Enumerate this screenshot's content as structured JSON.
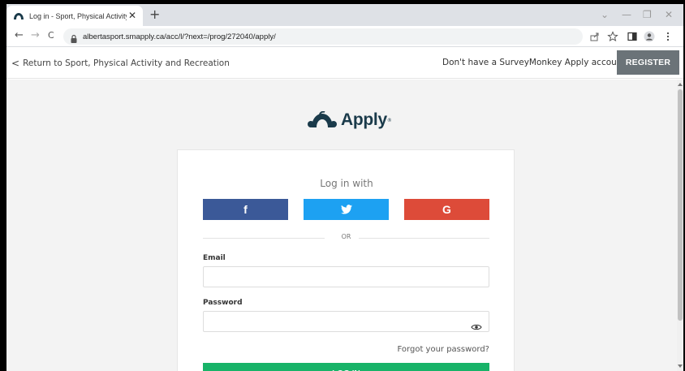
{
  "browser": {
    "tab_title": "Log in - Sport, Physical Activity a",
    "tab_close": "✕",
    "new_tab": "+",
    "window_controls": {
      "tabsearch": "⌄",
      "minimize": "—",
      "restore": "❐",
      "close": "✕"
    },
    "nav": {
      "back": "←",
      "forward": "→",
      "reload": "C"
    },
    "url": "albertasport.smapply.ca/acc/l/?next=/prog/272040/apply/"
  },
  "header": {
    "back_link": "Return to Sport, Physical Activity and Recreation",
    "back_chevron": "<",
    "no_account_text": "Don't have a SurveyMonkey Apply account?",
    "register_label": "REGISTER"
  },
  "logo": {
    "text": "Apply",
    "tm": "®"
  },
  "login": {
    "log_in_with": "Log in with",
    "facebook_label": "f",
    "google_label": "G",
    "or_text": "OR",
    "email_label": "Email",
    "email_value": "",
    "password_label": "Password",
    "password_value": "",
    "forgot_link": "Forgot your password?",
    "login_button": "LOG IN"
  },
  "colors": {
    "facebook": "#3b5998",
    "twitter": "#1da1f2",
    "google": "#dd4b39",
    "register": "#6b7378",
    "login": "#18b368",
    "logo": "#1a3a4a"
  },
  "icons": {
    "favicon": "surveymonkey-logo-icon",
    "lock": "lock-icon",
    "share": "share-icon",
    "bookmark": "star-icon",
    "sidepanel": "side-panel-icon",
    "profile": "profile-icon",
    "menu": "kebab-menu-icon",
    "twitter": "twitter-bird-icon",
    "eye": "eye-icon"
  }
}
